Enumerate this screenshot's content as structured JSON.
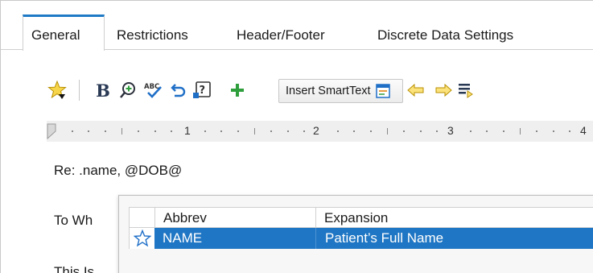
{
  "tabs": [
    {
      "label": "General",
      "active": true
    },
    {
      "label": "Restrictions",
      "active": false
    },
    {
      "label": "Header/Footer",
      "active": false
    },
    {
      "label": "Discrete Data Settings",
      "active": false
    }
  ],
  "toolbar": {
    "icons": [
      "favorite-star-icon",
      "bold-icon",
      "zoom-in-icon",
      "spellcheck-icon",
      "undo-icon",
      "help-icon",
      "add-icon",
      "insert-smarttext-icon",
      "arrow-left-icon",
      "arrow-right-icon",
      "list-arrow-icon"
    ],
    "bold_label": "B",
    "smarttext_label": "Insert SmartText",
    "colors": {
      "star": "#f2c200",
      "plus": "#2f9e3c",
      "undo": "#1f6fc7",
      "arrow": "#f2c200",
      "blue": "#1f6fc7"
    }
  },
  "ruler": {
    "numbers": [
      "1",
      "2",
      "3",
      "4"
    ]
  },
  "document": {
    "line1": "Re: .name, @DOB@",
    "line2": "To Wh",
    "line3": "This Is"
  },
  "popup": {
    "columns": [
      "Abbrev",
      "Expansion"
    ],
    "rows": [
      {
        "abbrev": "NAME",
        "expansion": "Patient’s Full Name",
        "selected": true
      }
    ],
    "selection_color": "#1f76c4"
  }
}
